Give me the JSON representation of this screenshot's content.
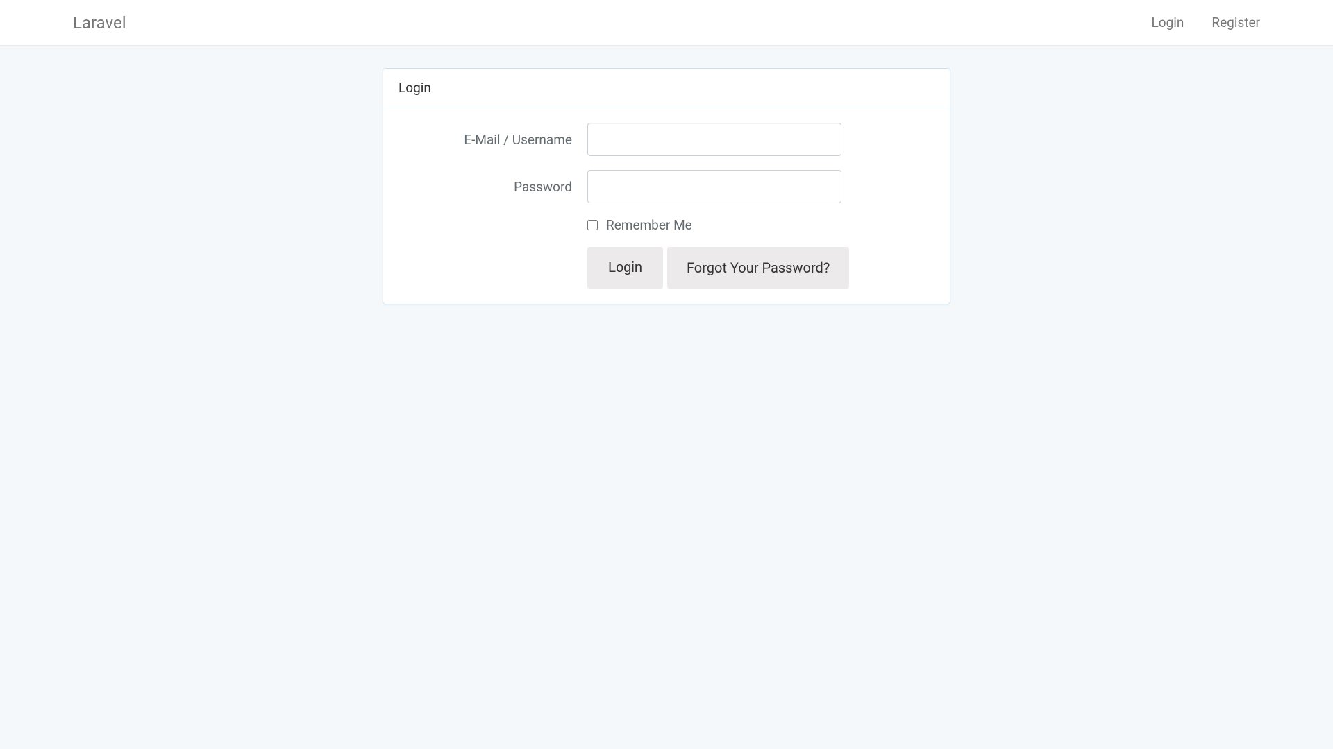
{
  "navbar": {
    "brand": "Laravel",
    "links": {
      "login": "Login",
      "register": "Register"
    }
  },
  "panel": {
    "heading": "Login"
  },
  "form": {
    "email_label": "E-Mail / Username",
    "email_value": "",
    "password_label": "Password",
    "password_value": "",
    "remember_label": "Remember Me",
    "login_button": "Login",
    "forgot_link": "Forgot Your Password?"
  }
}
